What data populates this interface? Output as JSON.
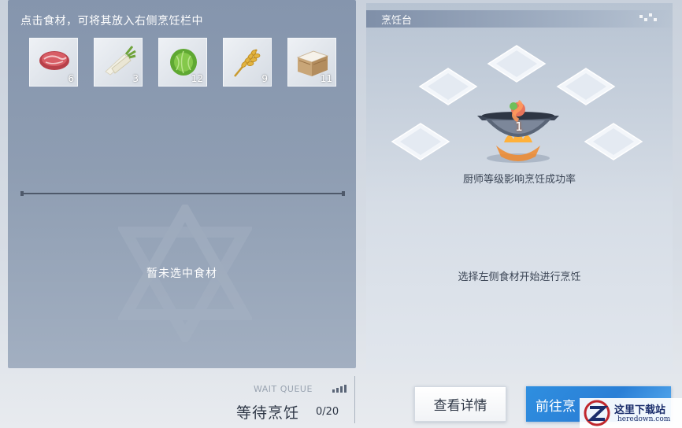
{
  "left_panel": {
    "hint": "点击食材，可将其放入右侧烹饪栏中",
    "empty_text": "暂未选中食材",
    "ingredients": [
      {
        "icon": "meat-icon",
        "count": "6"
      },
      {
        "icon": "radish-icon",
        "count": "3"
      },
      {
        "icon": "cabbage-icon",
        "count": "12"
      },
      {
        "icon": "wheat-icon",
        "count": "9"
      },
      {
        "icon": "rice-box-icon",
        "count": "11"
      }
    ]
  },
  "right_panel": {
    "title": "烹饪台",
    "pot_level": "1",
    "rate_text": "厨师等级影响烹饪成功率",
    "select_text": "选择左侧食材开始进行烹饪"
  },
  "bottom": {
    "wait_label": "WAIT QUEUE",
    "wait_status": "等待烹饪",
    "wait_count": "0/20",
    "detail_button": "查看详情",
    "go_button": "前往烹"
  },
  "watermark": {
    "cn": "这里下载站",
    "en": "heredown.com"
  },
  "colors": {
    "primary_button": "#2a7fd6",
    "panel_left": "#8595ad",
    "text_dark": "#2d3645"
  }
}
